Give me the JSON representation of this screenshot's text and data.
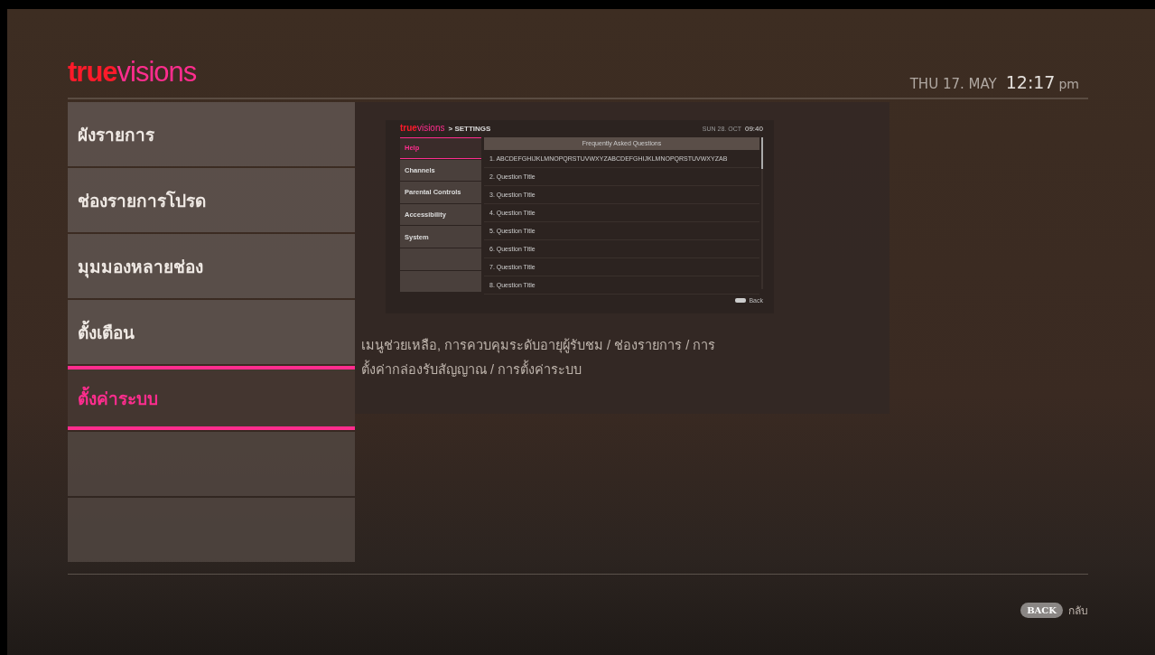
{
  "header": {
    "logo": {
      "part_1": "true",
      "part_2": "visions"
    },
    "date": "THU 17. MAY",
    "time": "12:17",
    "ampm": "pm"
  },
  "menu": {
    "items": [
      {
        "label": "ผังรายการ",
        "selected": false
      },
      {
        "label": "ช่องรายการโปรด",
        "selected": false
      },
      {
        "label": "มุมมองหลายช่อง",
        "selected": false
      },
      {
        "label": "ตั้งเตือน",
        "selected": false
      },
      {
        "label": "ตั้งค่าระบบ",
        "selected": true
      }
    ]
  },
  "preview": {
    "logo": {
      "part_1": "true",
      "part_2": "visions"
    },
    "breadcrumb": "> SETTINGS",
    "date": "SUN 28. OCT",
    "time": "09:40",
    "sidebar": [
      {
        "label": "Help",
        "selected": true
      },
      {
        "label": "Channels",
        "selected": false
      },
      {
        "label": "Parental Controls",
        "selected": false
      },
      {
        "label": "Accessibility",
        "selected": false
      },
      {
        "label": "System",
        "selected": false
      }
    ],
    "list_title": "Frequently Asked Questions",
    "questions": [
      "1. ABCDEFGHIJKLMNOPQRSTUVWXYZABCDEFGHIJKLMNOPQRSTUVWXYZAB",
      "2. Question Title",
      "3. Question Title",
      "4. Question Title",
      "5. Question Title",
      "6. Question Title",
      "7. Question Title",
      "8. Question Title"
    ],
    "back_label": "Back"
  },
  "description": "เมนูช่วยเหลือ, การควบคุมระดับอายุผู้รับชม / ช่องรายการ / การตั้งค่ากล่องรับสัญญาณ / การตั้งค่าระบบ",
  "footer": {
    "back_key": "BACK",
    "back_label": "กลับ"
  }
}
